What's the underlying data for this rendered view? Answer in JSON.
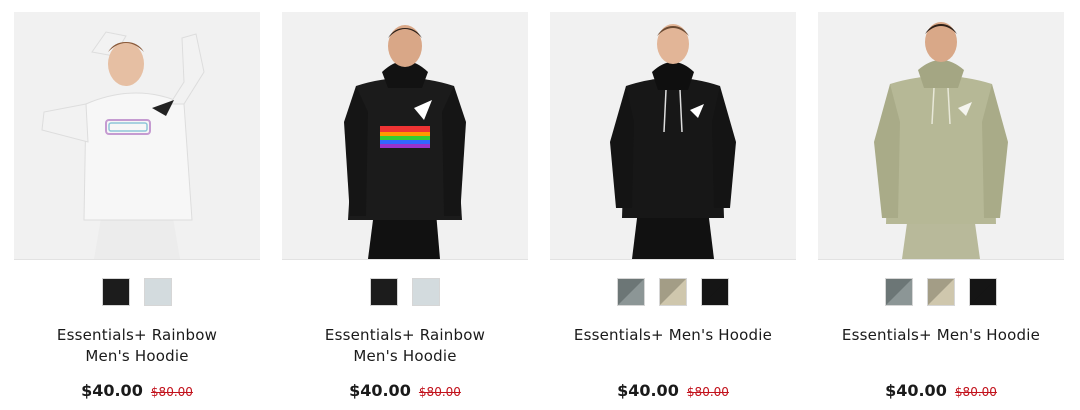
{
  "products": [
    {
      "name_line1": "Essentials+ Rainbow",
      "name_line2": "Men's Hoodie",
      "price": "$40.00",
      "old_price": "$80.00",
      "hoodie_color": "#f4f4f4",
      "swatches": [
        {
          "a": "#1c1c1c",
          "b": "#1c1c1c"
        },
        {
          "a": "#d3dbde",
          "b": "#d3dbde"
        }
      ]
    },
    {
      "name_line1": "Essentials+ Rainbow",
      "name_line2": "Men's Hoodie",
      "price": "$40.00",
      "old_price": "$80.00",
      "hoodie_color": "#1b1b1b",
      "swatches": [
        {
          "a": "#1c1c1c",
          "b": "#1c1c1c"
        },
        {
          "a": "#d3dbde",
          "b": "#d3dbde"
        }
      ]
    },
    {
      "name_line1": "Essentials+ Men's Hoodie",
      "name_line2": "",
      "price": "$40.00",
      "old_price": "$80.00",
      "hoodie_color": "#171717",
      "swatches": [
        {
          "a": "#6c7676",
          "b": "#8c9696"
        },
        {
          "a": "#a39d86",
          "b": "#cfc7ad"
        },
        {
          "a": "#151515",
          "b": "#151515"
        }
      ]
    },
    {
      "name_line1": "Essentials+ Men's Hoodie",
      "name_line2": "",
      "price": "$40.00",
      "old_price": "$80.00",
      "hoodie_color": "#b6b896",
      "swatches": [
        {
          "a": "#6c7676",
          "b": "#8c9696"
        },
        {
          "a": "#a39d86",
          "b": "#cfc7ad"
        },
        {
          "a": "#151515",
          "b": "#151515"
        }
      ]
    }
  ]
}
